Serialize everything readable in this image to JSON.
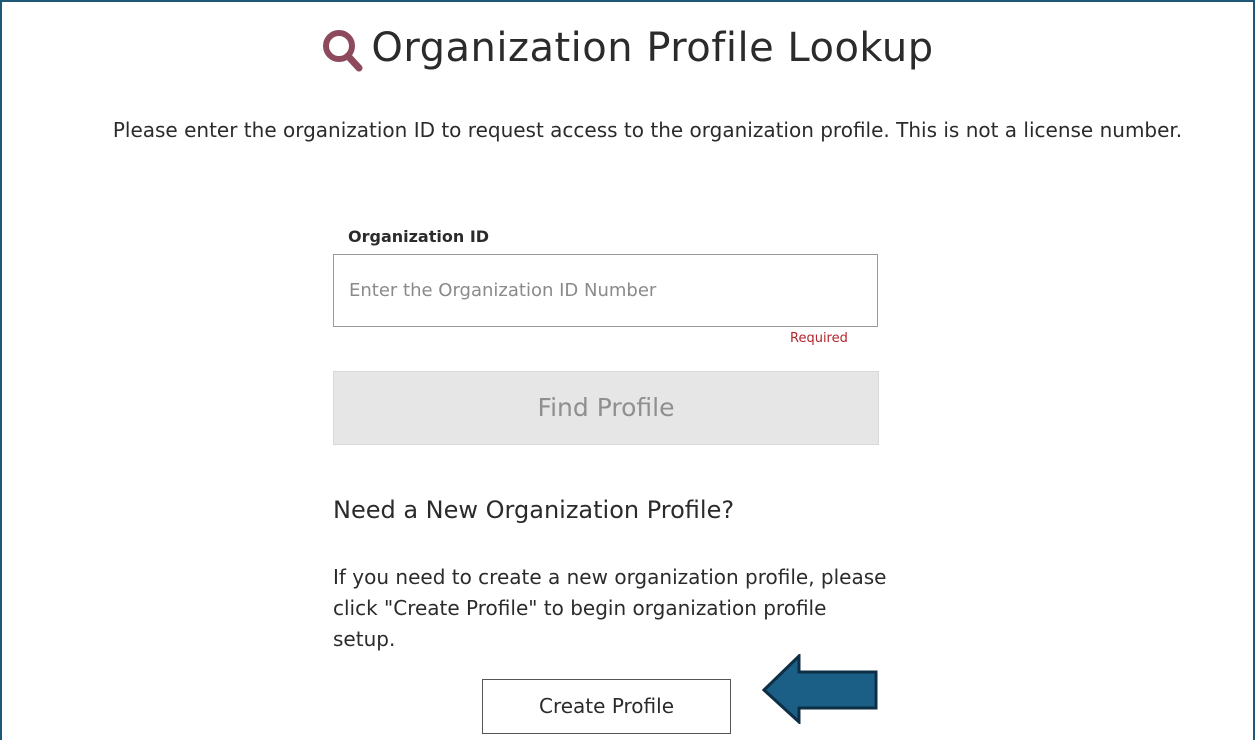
{
  "header": {
    "icon": "search-icon",
    "title": "Organization Profile Lookup"
  },
  "intro": {
    "text": "Please enter the organization ID to request access to the organization profile. This is not a license number."
  },
  "form": {
    "org_id_label": "Organization ID",
    "org_id_value": "",
    "org_id_placeholder": "Enter the Organization ID Number",
    "required_text": "Required",
    "find_button_label": "Find Profile"
  },
  "new_profile": {
    "heading": "Need a New Organization Profile?",
    "body": "If you need to create a new organization profile, please click \"Create Profile\" to begin organization profile setup.",
    "create_button_label": "Create Profile"
  },
  "annotation": {
    "arrow_icon": "left-arrow-icon"
  },
  "colors": {
    "icon_accent": "#8e4a5d",
    "frame_border": "#1f5777",
    "arrow_fill": "#1b5e86",
    "required": "#b3262e",
    "disabled_button_bg": "#e6e6e6"
  }
}
